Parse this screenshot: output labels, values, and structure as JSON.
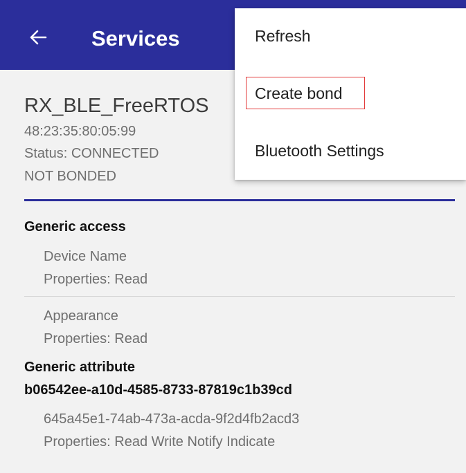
{
  "appbar": {
    "title": "Services",
    "back_icon": "arrow-left-icon",
    "background_color": "#2b2e9b"
  },
  "device": {
    "name": "RX_BLE_FreeRTOS",
    "address": "48:23:35:80:05:99",
    "status": "Status:  CONNECTED",
    "bond_state": "NOT BONDED"
  },
  "services": [
    {
      "title": "Generic access",
      "characteristics": [
        {
          "name": "Device Name",
          "properties": "Properties: Read"
        },
        {
          "name": "Appearance",
          "properties": "Properties: Read"
        }
      ]
    },
    {
      "title": "Generic attribute",
      "characteristics": []
    },
    {
      "title": "b06542ee-a10d-4585-8733-87819c1b39cd",
      "characteristics": [
        {
          "name": "645a45e1-74ab-473a-acda-9f2d4fb2acd3",
          "properties": "Properties: Read Write Notify Indicate"
        }
      ]
    }
  ],
  "overflow_menu": {
    "items": [
      {
        "label": "Refresh"
      },
      {
        "label": "Create bond",
        "highlighted": true
      },
      {
        "label": "Bluetooth Settings"
      }
    ],
    "highlight_color": "#e23a3a"
  }
}
